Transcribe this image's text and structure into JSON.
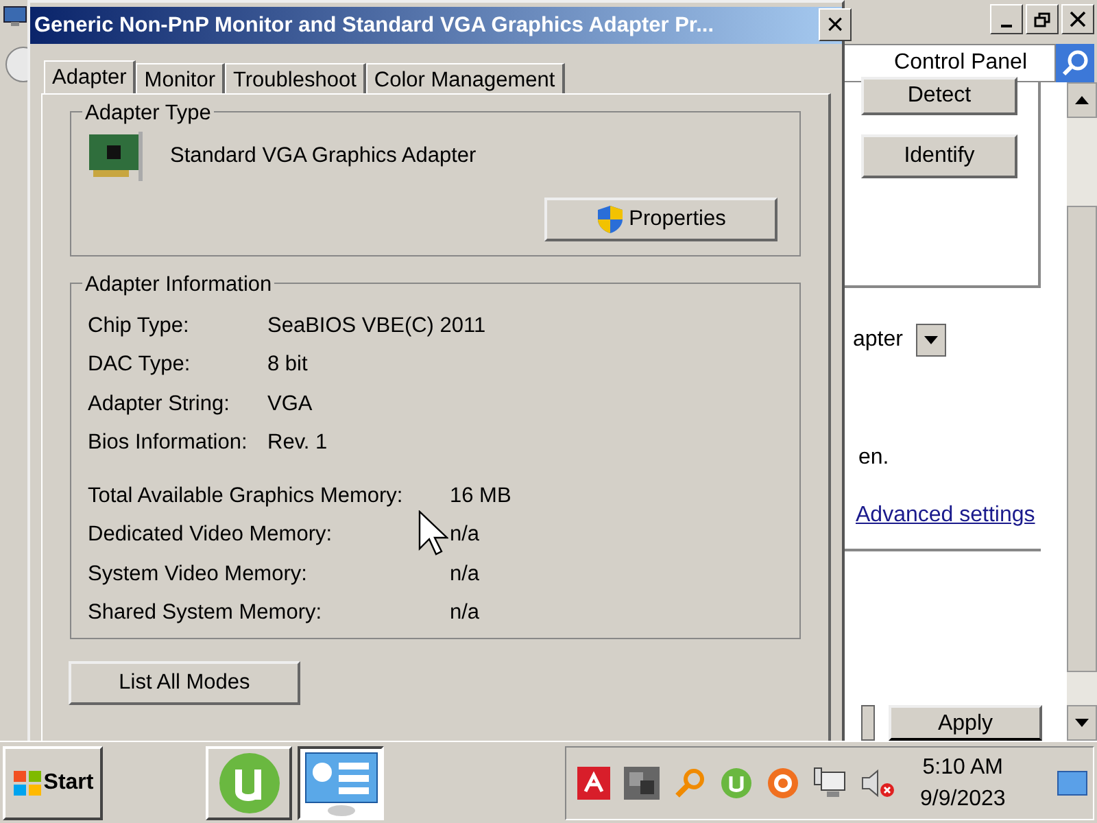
{
  "background_window": {
    "search": {
      "value": "Control Panel"
    },
    "buttons": [
      "Detect",
      "Identify"
    ],
    "dropdown": {
      "value": "apter"
    },
    "text": "en.",
    "link": "Advanced settings",
    "apply_button": "Apply"
  },
  "dialog": {
    "title": "Generic Non-PnP Monitor and Standard VGA Graphics Adapter Pr...",
    "close": "×",
    "tabs": [
      {
        "label": "Adapter",
        "selected": true
      },
      {
        "label": "Monitor",
        "selected": false
      },
      {
        "label": "Troubleshoot",
        "selected": false
      },
      {
        "label": "Color Management",
        "selected": false
      }
    ],
    "adapter_type": {
      "heading": "Adapter Type",
      "name": "Standard VGA Graphics Adapter",
      "properties_button": "Properties"
    },
    "adapter_information": {
      "heading": "Adapter Information",
      "details": [
        {
          "label": "Chip Type:",
          "value": "SeaBIOS VBE(C) 2011"
        },
        {
          "label": "DAC Type:",
          "value": "8 bit"
        },
        {
          "label": "Adapter String:",
          "value": "VGA"
        },
        {
          "label": "Bios Information:",
          "value": "Rev. 1"
        }
      ],
      "memory": [
        {
          "label": "Total Available Graphics Memory:",
          "value": "16 MB"
        },
        {
          "label": "Dedicated Video Memory:",
          "value": "n/a"
        },
        {
          "label": "System Video Memory:",
          "value": "n/a"
        },
        {
          "label": "Shared System Memory:",
          "value": "n/a"
        }
      ]
    },
    "list_modes_button": "List All Modes"
  },
  "taskbar": {
    "start": "Start",
    "apps": [
      {
        "kind": "torrent",
        "selected": false
      },
      {
        "kind": "display",
        "selected": true
      }
    ],
    "time": "5:10 AM",
    "date": "9/9/2023"
  }
}
